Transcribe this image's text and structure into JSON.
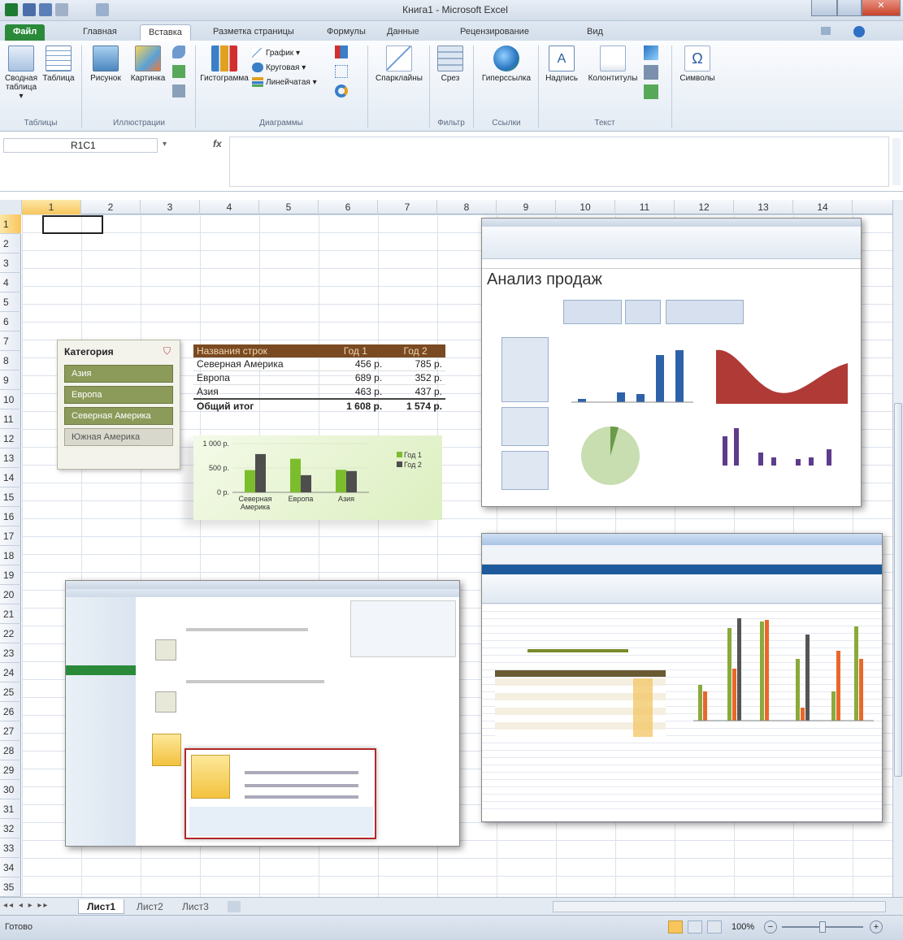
{
  "window": {
    "title": "Книга1 - Microsoft Excel"
  },
  "tabs": [
    {
      "label": "Файл"
    },
    {
      "label": "Главная"
    },
    {
      "label": "Вставка"
    },
    {
      "label": "Разметка страницы"
    },
    {
      "label": "Формулы"
    },
    {
      "label": "Данные"
    },
    {
      "label": "Рецензирование"
    },
    {
      "label": "Вид"
    }
  ],
  "ribbon": {
    "pivot_table": "Сводная таблица ▾",
    "table": "Таблица",
    "group_tables": "Таблицы",
    "picture": "Рисунок",
    "clipart": "Картинка",
    "group_illustrations": "Иллюстрации",
    "histogram": "Гистограмма",
    "graph": "График ▾",
    "pie": "Круговая ▾",
    "bar": "Линейчатая ▾",
    "group_charts": "Диаграммы",
    "sparklines": "Спарклайны",
    "slicer": "Срез",
    "group_filter": "Фильтр",
    "hyperlink": "Гиперссылка",
    "group_links": "Ссылки",
    "textbox": "Надпись",
    "headers": "Колонтитулы",
    "group_text": "Текст",
    "symbols": "Символы"
  },
  "formula_bar": {
    "name_box": "R1C1",
    "fx": "fx",
    "formula": ""
  },
  "columns": [
    "1",
    "2",
    "3",
    "4",
    "5",
    "6",
    "7",
    "8",
    "9",
    "10",
    "11",
    "12",
    "13",
    "14"
  ],
  "rows": [
    "1",
    "2",
    "3",
    "4",
    "5",
    "6",
    "7",
    "8",
    "9",
    "10",
    "11",
    "12",
    "13",
    "14",
    "15",
    "16",
    "17",
    "18",
    "19",
    "20",
    "21",
    "22",
    "23",
    "24",
    "25",
    "26",
    "27",
    "28",
    "29",
    "30",
    "31",
    "32",
    "33",
    "34",
    "35"
  ],
  "slicer": {
    "title": "Категория",
    "items": [
      {
        "label": "Азия",
        "selected": true
      },
      {
        "label": "Европа",
        "selected": true
      },
      {
        "label": "Северная Америка",
        "selected": true
      },
      {
        "label": "Южная Америка",
        "selected": false
      }
    ]
  },
  "pivot": {
    "headers": [
      "Названия строк",
      "Год 1",
      "Год 2"
    ],
    "rows": [
      [
        "Северная Америка",
        "456 р.",
        "785 р."
      ],
      [
        "Европа",
        "689 р.",
        "352 р."
      ],
      [
        "Азия",
        "463 р.",
        "437 р."
      ]
    ],
    "total": [
      "Общий итог",
      "1 608 р.",
      "1 574 р."
    ]
  },
  "chart_data": {
    "type": "bar",
    "categories": [
      "Северная Америка",
      "Европа",
      "Азия"
    ],
    "series": [
      {
        "name": "Год 1",
        "values": [
          456,
          689,
          463
        ],
        "color": "#7cbd2e"
      },
      {
        "name": "Год 2",
        "values": [
          785,
          352,
          437
        ],
        "color": "#4e4e4e"
      }
    ],
    "yticks": [
      "1 000 р.",
      "500 р.",
      "0 р."
    ],
    "ylim": [
      0,
      1000
    ],
    "legend": "right"
  },
  "thumb1": {
    "title": "Анализ продаж"
  },
  "sheets": [
    "Лист1",
    "Лист2",
    "Лист3"
  ],
  "status": {
    "ready": "Готово",
    "zoom": "100%"
  }
}
